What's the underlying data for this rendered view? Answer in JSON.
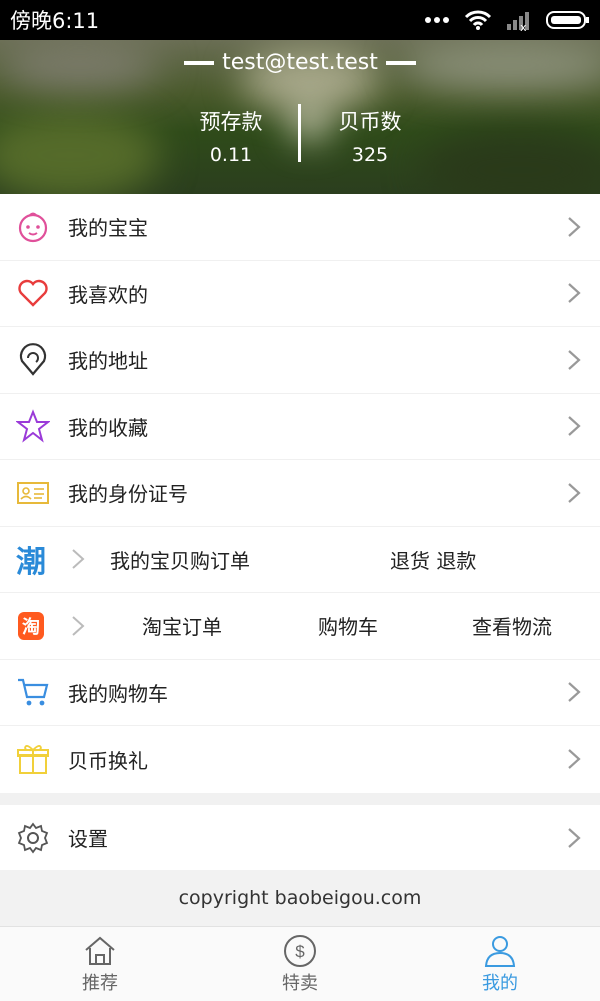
{
  "status_bar": {
    "time": "傍晚6:11"
  },
  "header": {
    "email": "test@test.test",
    "deposit_label": "预存款",
    "deposit_value": "0.11",
    "coins_label": "贝币数",
    "coins_value": "325"
  },
  "menu": [
    {
      "label": "我的宝宝",
      "icon": "baby-icon",
      "color": "#e0509a"
    },
    {
      "label": "我喜欢的",
      "icon": "heart-icon",
      "color": "#e83c3c"
    },
    {
      "label": "我的地址",
      "icon": "location-icon",
      "color": "#333333"
    },
    {
      "label": "我的收藏",
      "icon": "star-icon",
      "color": "#9a3ad8"
    },
    {
      "label": "我的身份证号",
      "icon": "id-card-icon",
      "color": "#e7b93a"
    }
  ],
  "chao_row": {
    "logo": "潮",
    "order": "我的宝贝购订单",
    "refund": "退货 退款"
  },
  "taobao_row": {
    "logo": "淘",
    "order": "淘宝订单",
    "cart": "购物车",
    "logistics": "查看物流"
  },
  "menu2": [
    {
      "label": "我的购物车",
      "icon": "cart-icon",
      "color": "#3a8ee0"
    },
    {
      "label": "贝币换礼",
      "icon": "gift-icon",
      "color": "#f1d03a"
    }
  ],
  "settings": {
    "label": "设置",
    "icon": "gear-icon"
  },
  "footer": {
    "copyright": "copyright baobeigou.com"
  },
  "bottom_nav": [
    {
      "label": "推荐",
      "icon": "home-icon"
    },
    {
      "label": "特卖",
      "icon": "dollar-icon"
    },
    {
      "label": "我的",
      "icon": "user-icon",
      "active": true
    }
  ]
}
